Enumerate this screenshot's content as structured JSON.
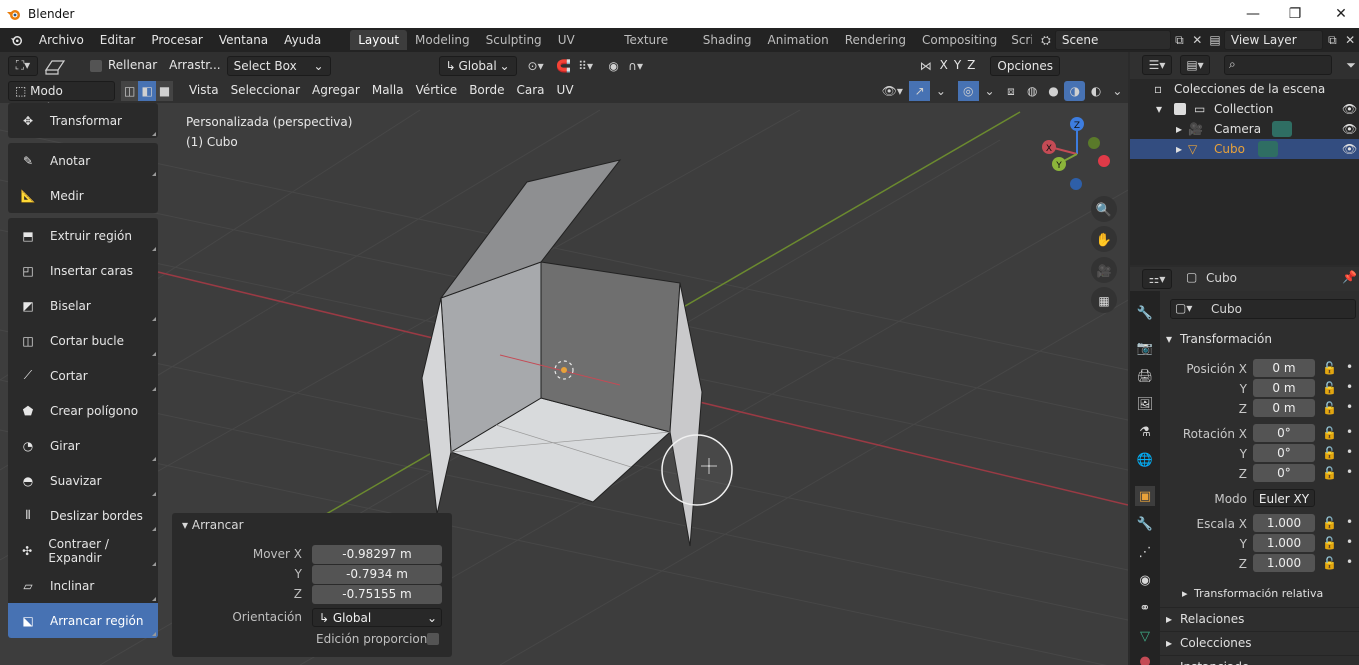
{
  "window": {
    "title": "Blender",
    "controls": [
      "—",
      "❐",
      "✕"
    ]
  },
  "menu": [
    "Archivo",
    "Editar",
    "Procesar",
    "Ventana",
    "Ayuda"
  ],
  "workspaces": [
    "Layout",
    "Modeling",
    "Sculpting",
    "UV Editing",
    "Texture Paint",
    "Shading",
    "Animation",
    "Rendering",
    "Compositing",
    "Scripti"
  ],
  "active_workspace": "Layout",
  "scene": "Scene",
  "view_layer": "View Layer",
  "header1": {
    "fill": "Rellenar",
    "drag": "Arrastr...",
    "select_box": "Select Box",
    "transform": "Global",
    "axes": [
      "X",
      "Y",
      "Z"
    ],
    "options": "Opciones"
  },
  "header2": {
    "mode": "Modo Edición",
    "menus": [
      "Vista",
      "Seleccionar",
      "Agregar",
      "Malla",
      "Vértice",
      "Borde",
      "Cara",
      "UV"
    ]
  },
  "viewport": {
    "line1": "Personalizada (perspectiva)",
    "line2": "(1) Cubo",
    "gizmo": {
      "x": "X",
      "y": "Y",
      "z": "Z"
    }
  },
  "tools": [
    [
      "Transformar"
    ],
    [
      "Anotar",
      "Medir"
    ],
    [
      "Extruir región",
      "Insertar caras",
      "Biselar",
      "Cortar bucle",
      "Cortar",
      "Crear polígono",
      "Girar",
      "Suavizar",
      "Deslizar bordes",
      "Contraer / Expandir",
      "Inclinar",
      "Arrancar región"
    ]
  ],
  "active_tool": "Arrancar región",
  "operator": {
    "title": "Arrancar",
    "move_label": "Mover X",
    "y_label": "Y",
    "z_label": "Z",
    "x": "-0.98297 m",
    "y": "-0.7934 m",
    "z": "-0.75155 m",
    "orientation_label": "Orientación",
    "orientation": "Global",
    "proportional": "Edición proporcional"
  },
  "outliner": {
    "root": "Colecciones de la escena",
    "collection": "Collection",
    "camera": "Camera",
    "cube": "Cubo"
  },
  "properties": {
    "object": "Cubo",
    "object_name": "Cubo",
    "transform": "Transformación",
    "pos_label": "Posición X",
    "rot_label": "Rotación X",
    "scale_label": "Escala X",
    "y": "Y",
    "z": "Z",
    "pos": [
      "0 m",
      "0 m",
      "0 m"
    ],
    "rot": [
      "0°",
      "0°",
      "0°"
    ],
    "mode_label": "Modo",
    "mode": "Euler XY",
    "scale": [
      "1.000",
      "1.000",
      "1.000"
    ],
    "delta": "Transformación relativa",
    "relations": "Relaciones",
    "collections": "Colecciones",
    "instancing": "Instanciado"
  },
  "colors": {
    "accent": "#4772b3",
    "x_axis": "#c44b55",
    "y_axis": "#7fa33a",
    "z_axis": "#3d7de0",
    "selected_object": "#e8a23a"
  }
}
